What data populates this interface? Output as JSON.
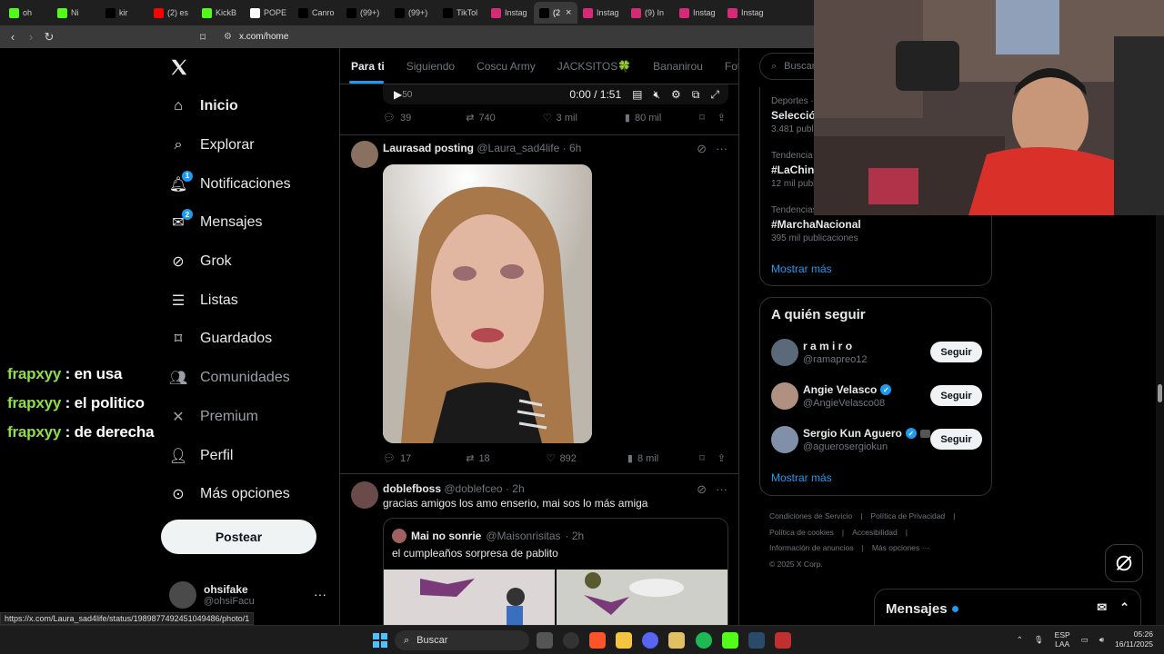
{
  "browser": {
    "tabs": [
      {
        "label": "oh",
        "color": "#53fc18"
      },
      {
        "label": "Ni",
        "color": "#53fc18"
      },
      {
        "label": "kir",
        "color": "#000000"
      },
      {
        "label": "(2) es",
        "color": "#ff0000"
      },
      {
        "label": "KickB",
        "color": "#53fc18"
      },
      {
        "label": "POPE",
        "color": "#ffffff"
      },
      {
        "label": "Canro",
        "color": "#000000"
      },
      {
        "label": "(99+)",
        "color": "#000000"
      },
      {
        "label": "(99+)",
        "color": "#000000"
      },
      {
        "label": "TikTol",
        "color": "#000000"
      },
      {
        "label": "Instag",
        "color": "#d62976"
      },
      {
        "label": "(2",
        "color": "#000000"
      },
      {
        "label": "Instag",
        "color": "#d62976"
      },
      {
        "label": "(9) In",
        "color": "#d62976"
      },
      {
        "label": "Instag",
        "color": "#d62976"
      },
      {
        "label": "Instag",
        "color": "#d62976"
      }
    ],
    "active_tab_index": 11,
    "url": "x.com/home",
    "status_url": "https://x.com/Laura_sad4life/status/1989877492451049486/photo/1"
  },
  "stream_chat": [
    {
      "user": "frapxyy",
      "text": ": en usa"
    },
    {
      "user": "frapxyy",
      "text": ": el politico"
    },
    {
      "user": "frapxyy",
      "text": ": de derecha"
    }
  ],
  "nav": {
    "items": [
      {
        "label": "Inicio",
        "icon": "home-icon",
        "badge": ""
      },
      {
        "label": "Explorar",
        "icon": "search-icon",
        "badge": ""
      },
      {
        "label": "Notificaciones",
        "icon": "bell-icon",
        "badge": "1"
      },
      {
        "label": "Mensajes",
        "icon": "mail-icon",
        "badge": "2"
      },
      {
        "label": "Grok",
        "icon": "grok-icon",
        "badge": ""
      },
      {
        "label": "Listas",
        "icon": "list-icon",
        "badge": ""
      },
      {
        "label": "Guardados",
        "icon": "bookmark-icon",
        "badge": ""
      },
      {
        "label": "Comunidades",
        "icon": "communities-icon",
        "badge": ""
      },
      {
        "label": "Premium",
        "icon": "x-logo-icon",
        "badge": ""
      },
      {
        "label": "Perfil",
        "icon": "person-icon",
        "badge": ""
      },
      {
        "label": "Más opciones",
        "icon": "more-circle-icon",
        "badge": ""
      }
    ],
    "post_button": "Postear",
    "account": {
      "name": "ohsifake",
      "handle": "@ohsiFacu"
    }
  },
  "timeline": {
    "tabs": [
      "Para ti",
      "Siguiendo",
      "Coscu Army",
      "JACKSITOS🍀",
      "Bananirou",
      "Fotos"
    ],
    "video": {
      "left": "50",
      "time": "0:00 / 1:51"
    },
    "tweets": [
      {
        "replies": "39",
        "reposts": "740",
        "likes": "3 mil",
        "views": "80 mil"
      },
      {
        "name": "Laurasad posting",
        "handle": "@Laura_sad4life",
        "time": "· 6h",
        "replies": "17",
        "reposts": "18",
        "likes": "892",
        "views": "8 mil"
      },
      {
        "name": "doblefboss",
        "handle": "@doblefceo",
        "time": "· 2h",
        "text": "gracias amigos los amo enserio, mai sos lo más amiga",
        "quote": {
          "name": "Mai no sonrie",
          "handle": "@Maisonrisitas",
          "time": "· 2h",
          "text": "el cumpleaños sorpresa de pablito"
        }
      }
    ]
  },
  "sidebar": {
    "search_placeholder": "Buscar",
    "trends": [
      {
        "context": "Deportes ·",
        "name": "Selección",
        "count": "3.481 publi"
      },
      {
        "context": "Tendencia",
        "name": "#LaChina",
        "count": "12 mil publ"
      },
      {
        "context": "Tendencias",
        "name": "#MarchaNacional",
        "count": "395 mil publicaciones"
      }
    ],
    "show_more": "Mostrar más",
    "who_to_follow": {
      "title": "A quién seguir",
      "accounts": [
        {
          "name": "r a m i r o",
          "handle": "@ramapreo12",
          "verified": false,
          "button": "Seguir"
        },
        {
          "name": "Angie Velasco",
          "handle": "@AngieVelasco08",
          "verified": true,
          "button": "Seguir"
        },
        {
          "name": "Sergio Kun Aguero",
          "handle": "@aguerosergiokun",
          "verified": true,
          "button": "Seguir"
        }
      ],
      "show_more": "Mostrar más"
    },
    "footer": [
      "Condiciones de Servicio",
      "|",
      "Política de Privacidad",
      "|",
      "Política de cookies",
      "|",
      "Accesibilidad",
      "|",
      "Información de anuncios",
      "|",
      "Más opciones ···",
      "© 2025 X Corp."
    ]
  },
  "messages_drawer": {
    "title": "Mensajes"
  },
  "taskbar": {
    "search": "Buscar",
    "lang_top": "ESP",
    "lang_bottom": "LAA",
    "time": "05:26",
    "date": "16/11/2025"
  },
  "colors": {
    "accent": "#1d9bf0",
    "chat_user": "#8ddf4a",
    "kick_green": "#53fc18"
  }
}
